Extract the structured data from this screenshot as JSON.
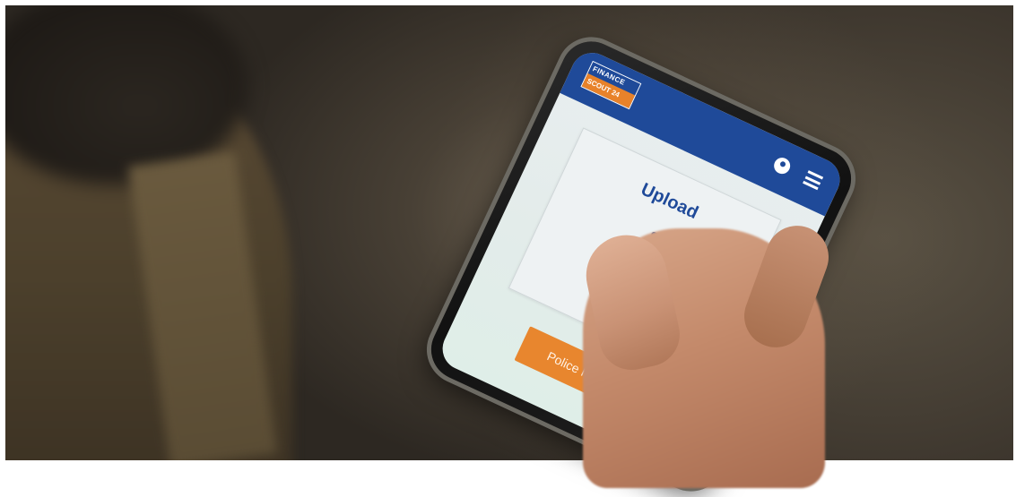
{
  "app": {
    "logo": {
      "line1": "FINANCE",
      "line2": "SCOUT 24"
    },
    "header": {
      "account_icon": "account-circle-icon",
      "menu_icon": "hamburger-menu-icon"
    },
    "upload_card": {
      "title": "Upload",
      "progress_indicator": "circular-progress-icon"
    },
    "upload_button_label": "Police hochladen"
  },
  "colors": {
    "brand_blue": "#1f4a99",
    "accent_orange": "#e8862e"
  }
}
